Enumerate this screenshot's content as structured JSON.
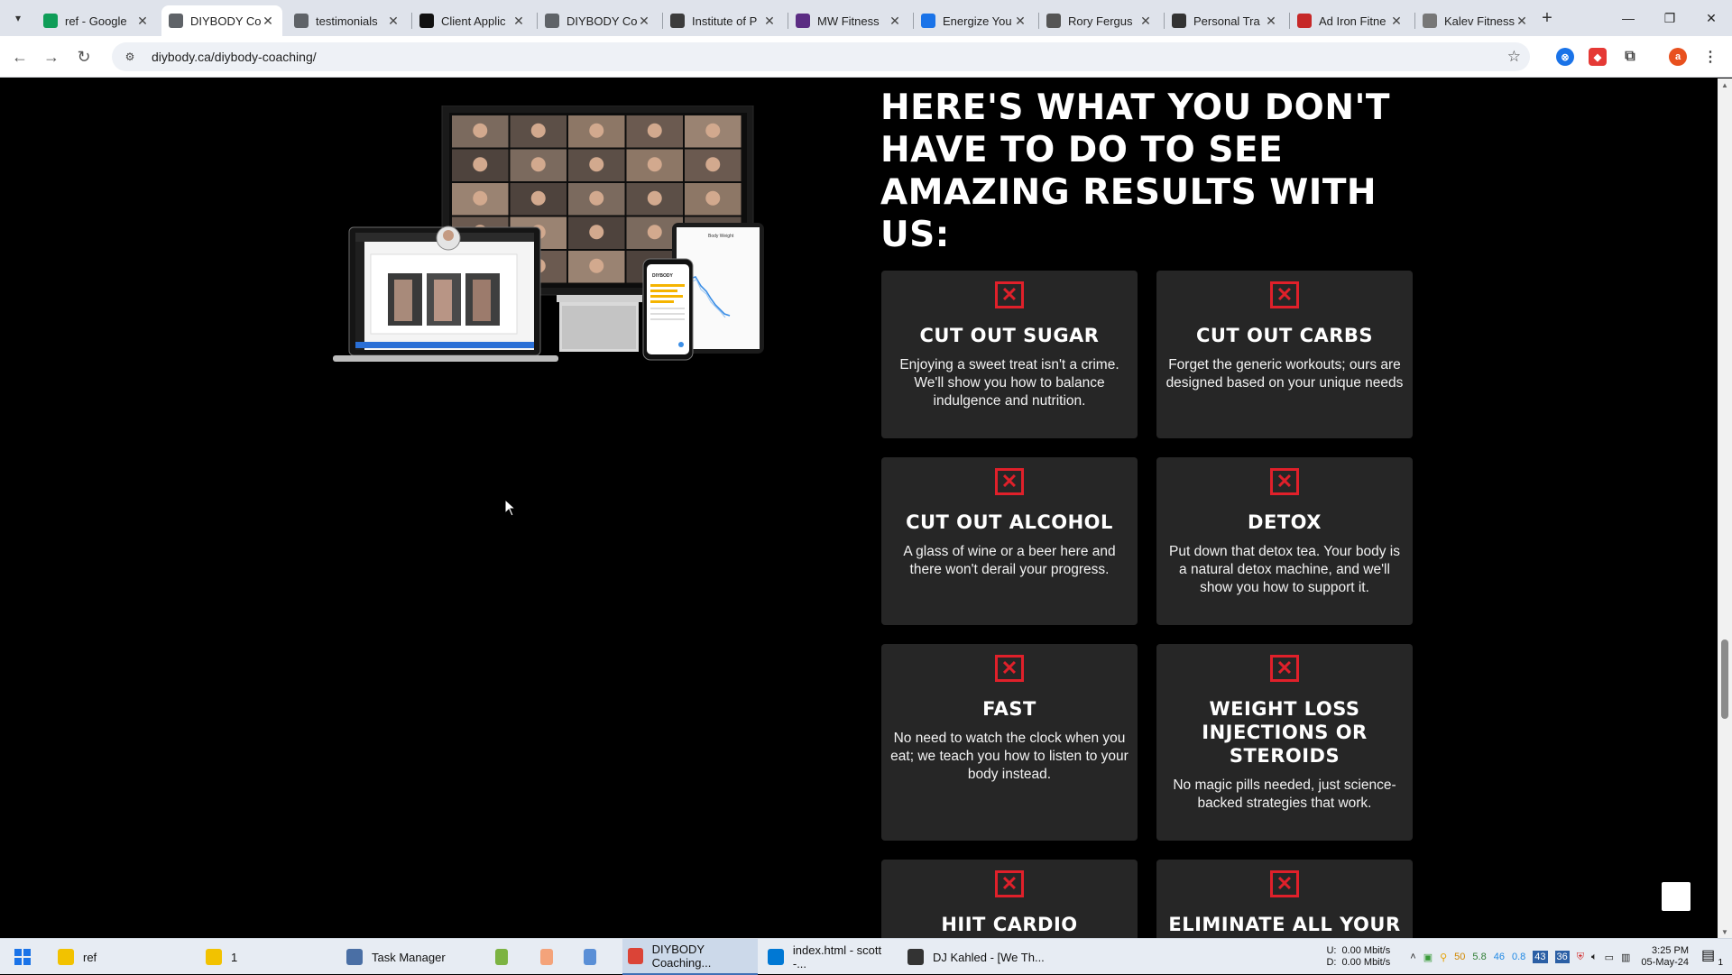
{
  "browser": {
    "tabs": [
      {
        "title": "ref - Google",
        "icon": "sheets-icon",
        "color": "#0f9d58"
      },
      {
        "title": "DIYBODY Co",
        "icon": "globe-icon",
        "color": "#5f6368",
        "active": true
      },
      {
        "title": "testimonials",
        "icon": "globe-icon",
        "color": "#5f6368"
      },
      {
        "title": "Client Applic",
        "icon": "form-icon",
        "color": "#111111"
      },
      {
        "title": "DIYBODY Co",
        "icon": "globe-icon",
        "color": "#5f6368"
      },
      {
        "title": "Institute of P",
        "icon": "shield-icon",
        "color": "#3c3c3c"
      },
      {
        "title": "MW Fitness",
        "icon": "mw-icon",
        "color": "#5b2c83"
      },
      {
        "title": "Energize You",
        "icon": "energize-icon",
        "color": "#1a73e8"
      },
      {
        "title": "Rory Fergus",
        "icon": "rory-icon",
        "color": "#555555"
      },
      {
        "title": "Personal Tra",
        "icon": "personal-icon",
        "color": "#333333"
      },
      {
        "title": "Ad Iron Fitne",
        "icon": "iron-icon",
        "color": "#c62828"
      },
      {
        "title": "Kalev Fitness",
        "icon": "kalev-icon",
        "color": "#777777"
      }
    ],
    "url": "diybody.ca/diybody-coaching/"
  },
  "section": {
    "heading": "HERE'S WHAT YOU DON'T HAVE TO DO TO SEE AMAZING RESULTS WITH US:",
    "cards": [
      {
        "title": "CUT OUT SUGAR",
        "text": "Enjoying a sweet treat isn't a crime. We'll show you how to balance indulgence and nutrition."
      },
      {
        "title": "CUT OUT CARBS",
        "text": "Forget the generic workouts; ours are designed based on your unique needs"
      },
      {
        "title": "CUT OUT ALCOHOL",
        "text": "A glass of wine or a beer here and there won't derail your progress."
      },
      {
        "title": "DETOX",
        "text": "Put down that detox tea. Your body is a natural detox machine, and we'll show you how to support it."
      },
      {
        "title": "FAST",
        "text": "No need to watch the clock when you eat; we teach you how to listen to your body instead."
      },
      {
        "title": "WEIGHT LOSS INJECTIONS OR STEROIDS",
        "text": "No magic pills needed, just science-backed strategies that work."
      },
      {
        "title": "HIIT CARDIO",
        "text": ""
      },
      {
        "title": "ELIMINATE ALL YOUR",
        "text": ""
      }
    ],
    "phone_brand": "DIYBODY",
    "chart_label": "Body Weight",
    "accent": "#e0202a"
  },
  "taskbar": {
    "items": [
      {
        "label": "ref",
        "icon": "folder-icon",
        "color": "#f2c200"
      },
      {
        "label": "1",
        "icon": "folder-icon",
        "color": "#f2c200"
      },
      {
        "label": "Task Manager",
        "icon": "task-manager-icon",
        "color": "#4a6fa5"
      },
      {
        "label": "",
        "icon": "notepad-plus-icon",
        "color": "#7cb342"
      },
      {
        "label": "",
        "icon": "app-face-icon",
        "color": "#f4a37a"
      },
      {
        "label": "",
        "icon": "notepad-icon",
        "color": "#5a8fd6"
      },
      {
        "label": "DIYBODY Coaching...",
        "icon": "chrome-icon",
        "color": "#db4437",
        "active": true
      },
      {
        "label": "index.html - scott -...",
        "icon": "vscode-icon",
        "color": "#0078d4"
      },
      {
        "label": "DJ Kahled - [We Th...",
        "icon": "winamp-icon",
        "color": "#333333"
      }
    ],
    "net_up_label": "U:",
    "net_down_label": "D:",
    "net_up": "0.00 Mbit/s",
    "net_down": "0.00 Mbit/s",
    "tray_numbers": [
      "50",
      "5.8",
      "46",
      "0.8"
    ],
    "tray_badges": [
      "43",
      "36"
    ],
    "time": "3:25 PM",
    "date": "05-May-24",
    "notif_count": "1"
  }
}
